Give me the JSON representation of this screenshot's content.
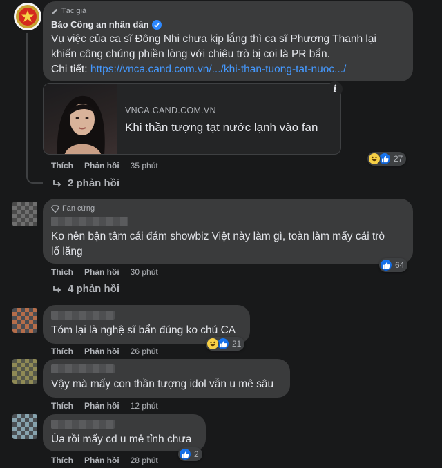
{
  "post": {
    "badge": "Tác giả",
    "author": "Báo Công an nhân dân",
    "text_line1": "Vụ việc của ca sĩ Đông Nhi chưa kịp lắng thì ca sĩ Phương Thanh lại",
    "text_line2": "khiến công chúng phiền lòng với chiêu trò bị coi là PR bẩn.",
    "detail_label": "Chi tiết:",
    "detail_link": "https://vnca.cand.com.vn/.../khi-than-tuong-tat-nuoc.../",
    "preview": {
      "domain": "VNCA.CAND.COM.VN",
      "title": "Khi thần tượng tạt nước lạnh vào fan",
      "info": "i"
    },
    "actions": {
      "like": "Thích",
      "reply": "Phản hồi",
      "time": "35 phút"
    },
    "reaction_count": "27",
    "replies_label": "2 phản hồi"
  },
  "comments": [
    {
      "badge": "Fan cứng",
      "text_line1": "Ko nên bận tâm cái đám showbiz Việt này làm gì, toàn làm mấy cái trò",
      "text_line2": "lố lăng",
      "actions": {
        "like": "Thích",
        "reply": "Phản hồi",
        "time": "30 phút"
      },
      "reaction_count": "64",
      "replies_label": "4 phản hồi"
    },
    {
      "text_line1": "Tóm lại là nghệ sĩ bẩn đúng ko chú CA",
      "actions": {
        "like": "Thích",
        "reply": "Phản hồi",
        "time": "26 phút"
      },
      "reaction_count": "21"
    },
    {
      "text_line1": "Vậy mà mấy con thần tượng idol vẫn u mê sâu",
      "actions": {
        "like": "Thích",
        "reply": "Phản hồi",
        "time": "12 phút"
      }
    },
    {
      "text_line1": "Úa rồi mấy cd u mê tỉnh chưa",
      "actions": {
        "like": "Thích",
        "reply": "Phản hồi",
        "time": "28 phút"
      },
      "reaction_count": "2"
    }
  ],
  "colors": {
    "background": "#18191a",
    "bubble": "#3a3b3c",
    "link": "#4599ff",
    "verified": "#2d88ff",
    "like": "#1877f2"
  }
}
